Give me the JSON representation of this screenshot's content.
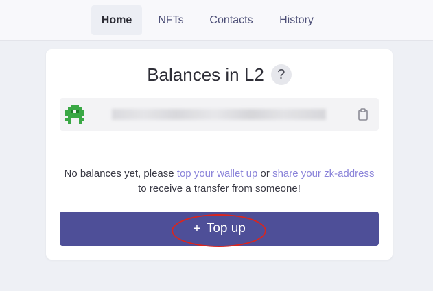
{
  "nav": {
    "tabs": [
      {
        "label": "Home",
        "active": true
      },
      {
        "label": "NFTs",
        "active": false
      },
      {
        "label": "Contacts",
        "active": false
      },
      {
        "label": "History",
        "active": false
      }
    ]
  },
  "card": {
    "title": "Balances in L2",
    "help_glyph": "?",
    "address": {
      "value_obscured": "",
      "copy_icon": "clipboard-icon",
      "avatar_icon": "identicon-avatar"
    },
    "message": {
      "prefix": "No balances yet, please ",
      "link1": "top your wallet up",
      "middle": " or ",
      "link2": "share your zk-address",
      "suffix": " to receive a transfer from someone!"
    },
    "topup": {
      "icon": "+",
      "label": "Top up"
    }
  },
  "colors": {
    "accent": "#4e4f98",
    "link": "#8a83d9",
    "highlight": "#d9261f",
    "avatar_green": "#3aa845"
  }
}
